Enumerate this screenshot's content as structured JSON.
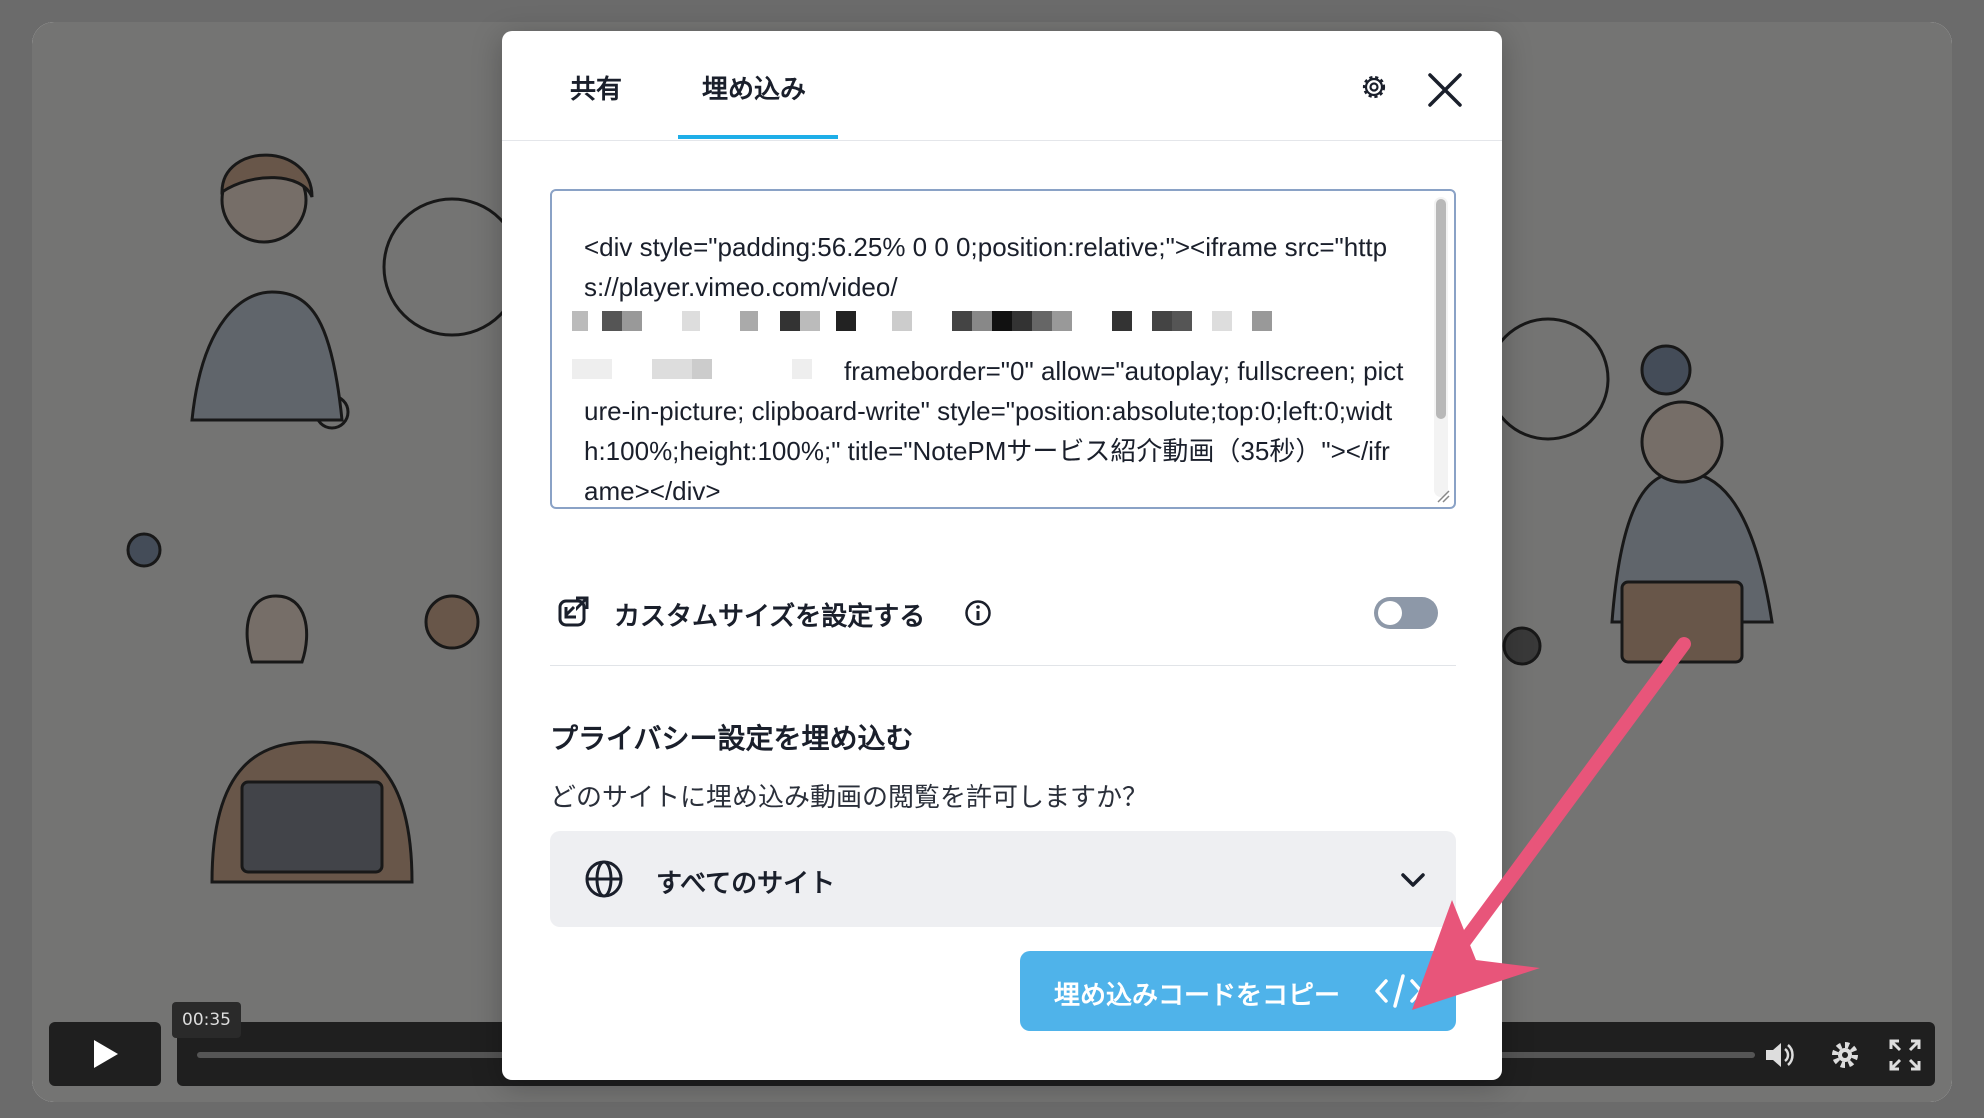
{
  "player": {
    "time": "00:35"
  },
  "modal": {
    "tabs": [
      {
        "label": "共有"
      },
      {
        "label": "埋め込み"
      }
    ],
    "embed_code": {
      "line1": "<div style=\"padding:56.25% 0 0 0;position:relative;\"><iframe src=\"https://player.vimeo.com/video/",
      "line2": "frameborder=\"0\" allow=\"autoplay; fullscreen; picture-in-picture; clipboard-write\" style=\"position:absolute;top:0;left:0;width:100%;height:100%;\" title=\"NotePMサービス紹介動画（35秒）\"></iframe></div>"
    },
    "custom_size": {
      "label": "カスタムサイズを設定する",
      "enabled": false
    },
    "privacy": {
      "title": "プライバシー設定を埋め込む",
      "question": "どのサイトに埋め込み動画の閲覧を許可しますか？",
      "selected": "すべてのサイト"
    },
    "copy_button": {
      "label": "埋め込みコードをコピー"
    }
  },
  "colors": {
    "accent": "#1eaee8",
    "button": "#4fb3ea",
    "arrow": "#e8557a"
  }
}
